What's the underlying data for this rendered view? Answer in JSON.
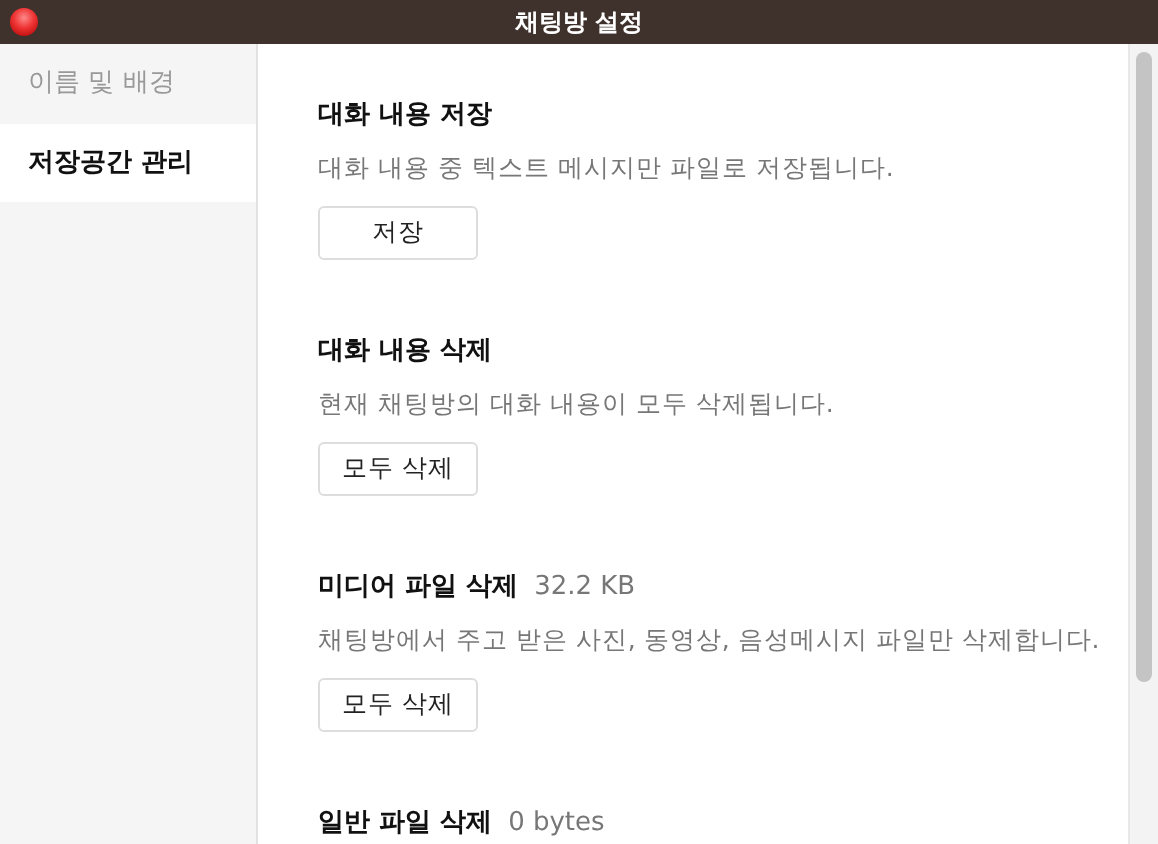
{
  "window": {
    "title": "채팅방 설정"
  },
  "sidebar": {
    "items": [
      {
        "label": "이름 및 배경",
        "selected": false
      },
      {
        "label": "저장공간 관리",
        "selected": true
      }
    ]
  },
  "sections": [
    {
      "title": "대화 내용 저장",
      "description": "대화 내용 중 텍스트 메시지만 파일로 저장됩니다.",
      "button": "저장"
    },
    {
      "title": "대화 내용 삭제",
      "description": "현재 채팅방의 대화 내용이 모두 삭제됩니다.",
      "button": "모두 삭제"
    },
    {
      "title": "미디어 파일 삭제",
      "size": "32.2 KB",
      "description": "채팅방에서 주고 받은 사진, 동영상, 음성메시지 파일만 삭제합니다.",
      "button": "모두 삭제"
    },
    {
      "title": "일반 파일 삭제",
      "size": "0 bytes"
    }
  ]
}
